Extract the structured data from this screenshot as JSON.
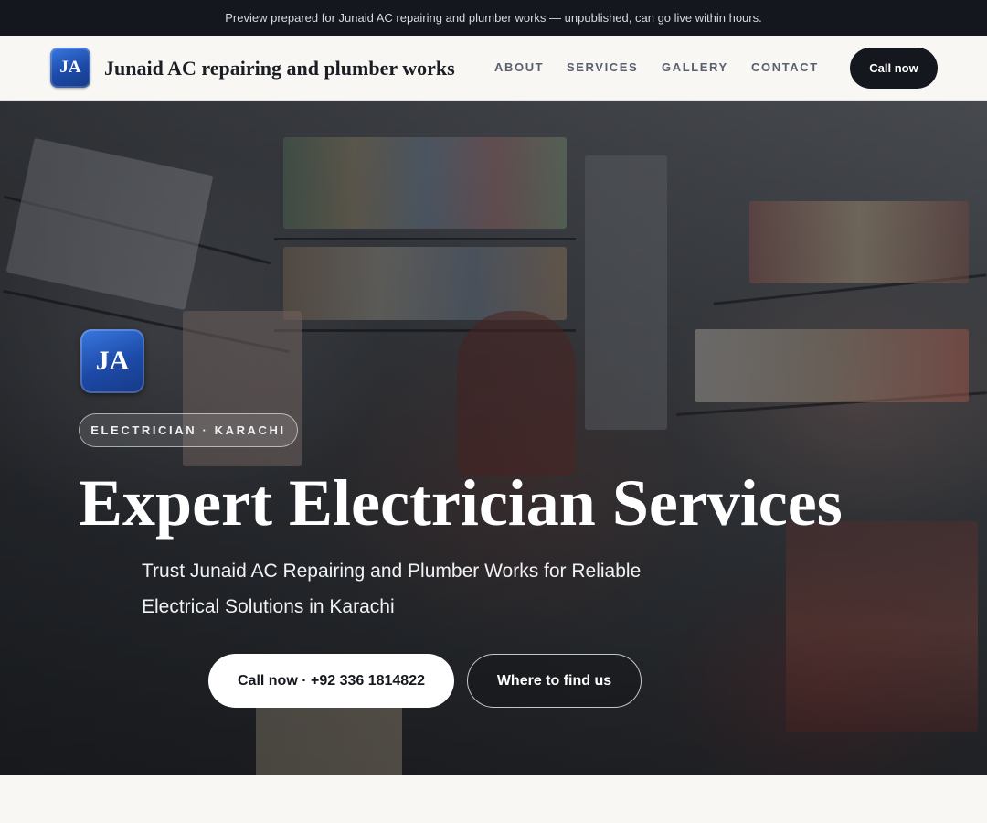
{
  "preview_bar": {
    "text": "Preview prepared for Junaid AC repairing and plumber works — unpublished, can go live within hours."
  },
  "header": {
    "logo_initials": "JA",
    "brand_name": "Junaid AC repairing and plumber works",
    "nav": [
      {
        "label": "ABOUT"
      },
      {
        "label": "SERVICES"
      },
      {
        "label": "GALLERY"
      },
      {
        "label": "CONTACT"
      }
    ],
    "call_button": "Call now"
  },
  "hero": {
    "logo_initials": "JA",
    "tag": "ELECTRICIAN · KARACHI",
    "title": "Expert Electrician Services",
    "subtitle": "Trust Junaid AC Repairing and Plumber Works for Reliable Electrical Solutions in Karachi",
    "primary_button": "Call now · +92 336 1814822",
    "secondary_button": "Where to find us"
  },
  "colors": {
    "accent_blue": "#1d4aa8",
    "dark": "#14171d",
    "page_background": "#f8f7f4"
  }
}
